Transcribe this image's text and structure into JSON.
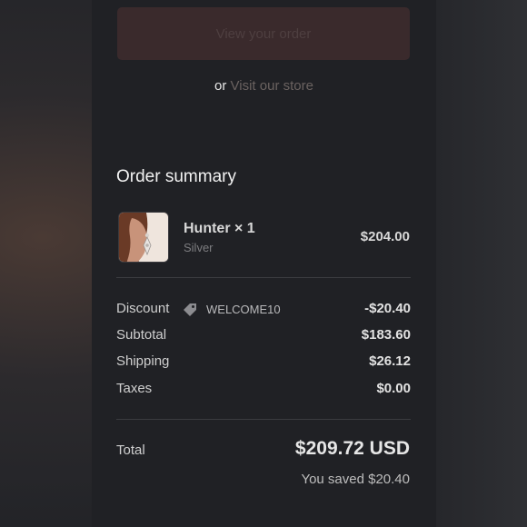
{
  "buttons": {
    "view_order": "View your order"
  },
  "visit": {
    "prefix": "or",
    "link": "Visit our store"
  },
  "summary": {
    "title": "Order summary",
    "item": {
      "name": "Hunter × 1",
      "variant": "Silver",
      "price": "$204.00",
      "image": "earring-product-photo"
    },
    "discount": {
      "label": "Discount",
      "icon": "tag-icon",
      "code": "WELCOME10",
      "value": "-$20.40"
    },
    "subtotal": {
      "label": "Subtotal",
      "value": "$183.60"
    },
    "shipping": {
      "label": "Shipping",
      "value": "$26.12"
    },
    "taxes": {
      "label": "Taxes",
      "value": "$0.00"
    },
    "total": {
      "label": "Total",
      "value": "$209.72 USD"
    },
    "saved": "You saved $20.40"
  },
  "colors": {
    "panel_bg": "#202125",
    "button_bg": "#3a2a2c",
    "link": "#6a6260"
  }
}
